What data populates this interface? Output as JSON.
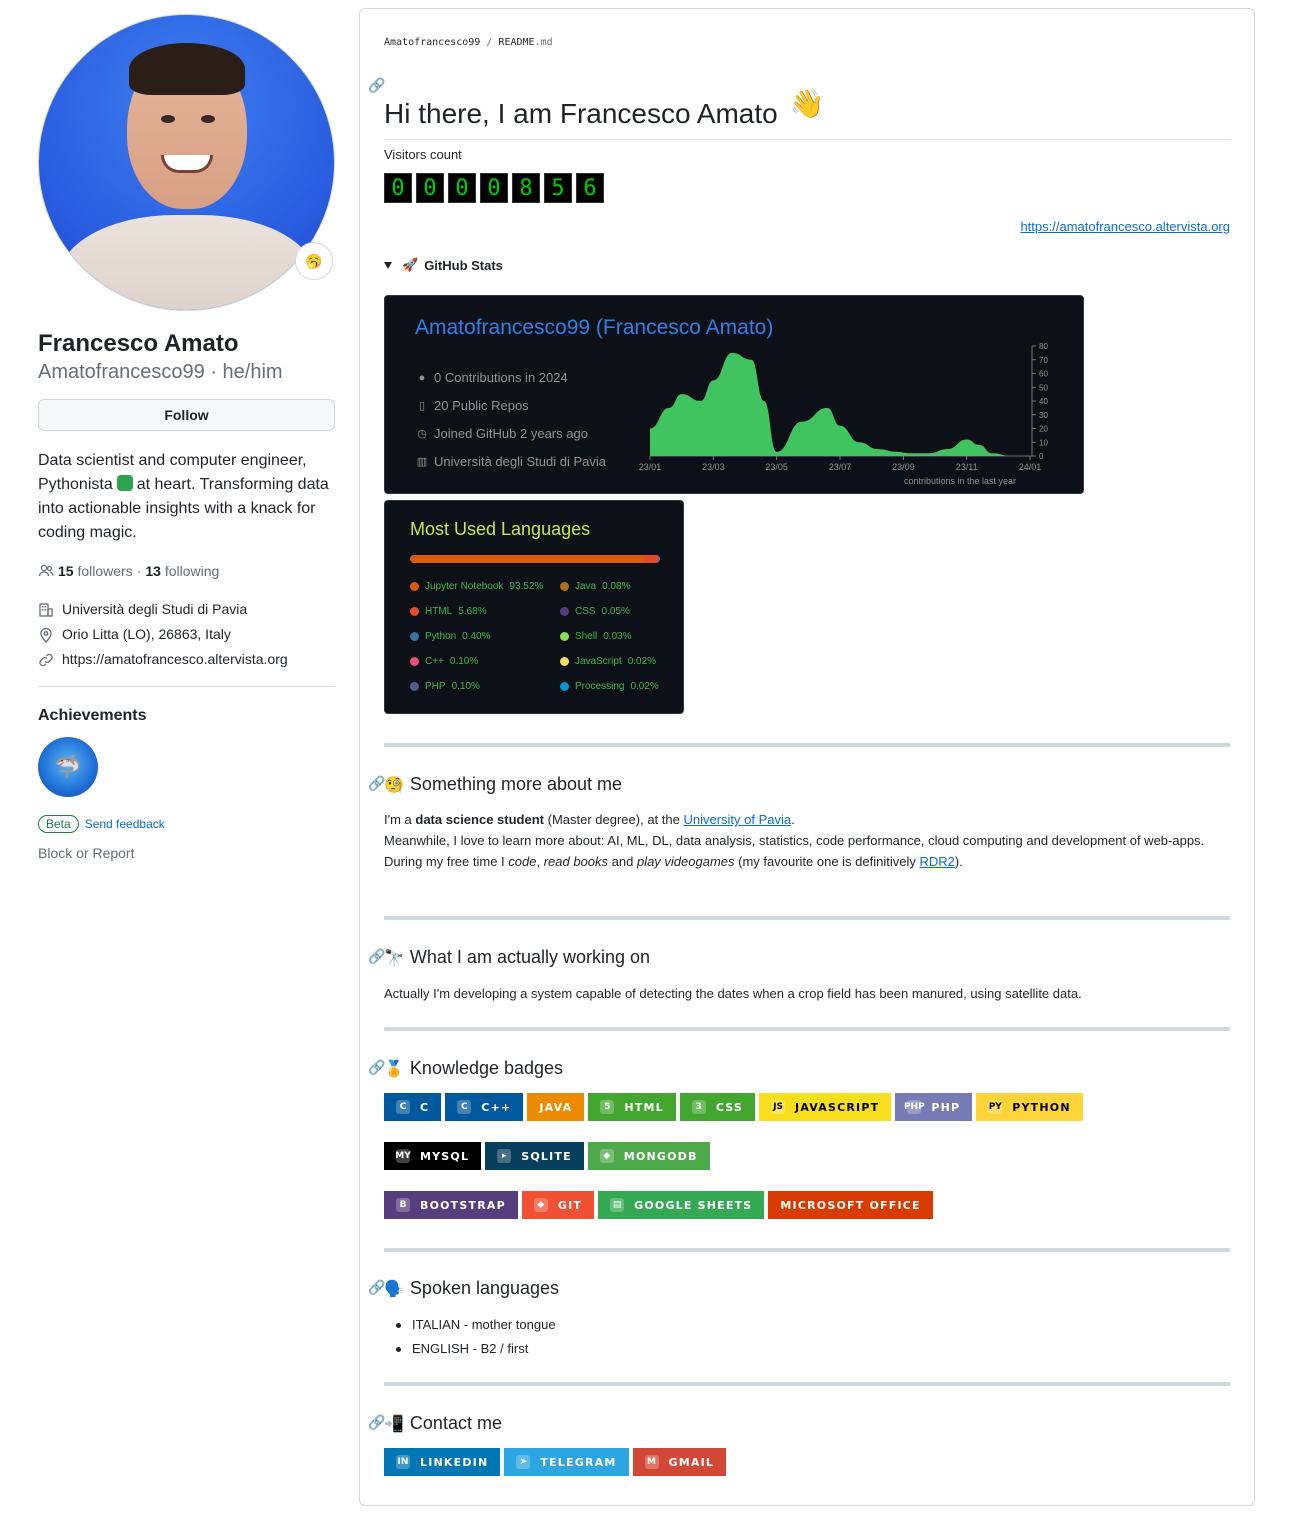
{
  "profile": {
    "name": "Francesco Amato",
    "username": "Amatofrancesco99 · he/him",
    "status_emoji": "🥱",
    "follow_label": "Follow",
    "bio_part1": "Data scientist and computer engineer, Pythonista",
    "bio_part2": "at heart. Transforming data into actionable insights with a knack for coding magic.",
    "followers_count": "15",
    "followers_label": "followers",
    "following_count": "13",
    "following_label": "following",
    "organization": "Università degli Studi di Pavia",
    "location": "Orio Litta (LO), 26863, Italy",
    "website": "https://amatofrancesco.altervista.org",
    "achievements_title": "Achievements",
    "beta_label": "Beta",
    "feedback_label": "Send feedback",
    "block_label": "Block or Report"
  },
  "readme": {
    "crumb_user": "Amatofrancesco99",
    "crumb_sep": "/",
    "crumb_file": "README",
    "crumb_ext": ".md",
    "title": "Hi there, I am Francesco Amato",
    "title_emoji": "👋",
    "visitors_label": "Visitors count",
    "visitor_digits": [
      "0",
      "0",
      "0",
      "0",
      "8",
      "5",
      "6"
    ],
    "site_link": "https://amatofrancesco.altervista.org",
    "details_emoji": "🚀",
    "details_label": "GitHub Stats"
  },
  "stats_card": {
    "title": "Amatofrancesco99 (Francesco Amato)",
    "contributions": "0 Contributions in 2024",
    "repos": "20 Public Repos",
    "joined": "Joined GitHub 2 years ago",
    "org": "Università degli Studi di Pavia",
    "caption": "contributions in the last year"
  },
  "chart_data": {
    "type": "area",
    "title": "",
    "xlabel": "contributions in the last year",
    "ylabel": "",
    "x_ticks": [
      "23/01",
      "23/03",
      "23/05",
      "23/07",
      "23/09",
      "23/11",
      "24/01"
    ],
    "y_ticks": [
      0,
      10,
      20,
      30,
      40,
      50,
      60,
      70,
      80
    ],
    "ylim": [
      0,
      80
    ],
    "series": [
      {
        "x": [
          0,
          0.3,
          0.5,
          0.8,
          1.0,
          1.3,
          1.6,
          1.8,
          2.0,
          2.4,
          2.8,
          3.0,
          3.3,
          3.6,
          3.9,
          4.1,
          4.4,
          4.7,
          5.0,
          5.2,
          5.4,
          5.7,
          6.0
        ],
        "y": [
          20,
          35,
          45,
          40,
          55,
          75,
          70,
          40,
          3,
          25,
          35,
          22,
          10,
          5,
          3,
          2,
          2,
          5,
          12,
          8,
          2,
          0,
          0
        ]
      }
    ],
    "color": "#3fc45f"
  },
  "lang_card": {
    "title": "Most Used Languages",
    "languages": [
      {
        "name": "Jupyter Notebook",
        "pct": "93.52%",
        "value": 93.52,
        "color": "#DA5B0B"
      },
      {
        "name": "Java",
        "pct": "0.08%",
        "value": 0.08,
        "color": "#b07219"
      },
      {
        "name": "HTML",
        "pct": "5.68%",
        "value": 5.68,
        "color": "#e34c26"
      },
      {
        "name": "CSS",
        "pct": "0.05%",
        "value": 0.05,
        "color": "#563d7c"
      },
      {
        "name": "Python",
        "pct": "0.40%",
        "value": 0.4,
        "color": "#3572A5"
      },
      {
        "name": "Shell",
        "pct": "0.03%",
        "value": 0.03,
        "color": "#89e051"
      },
      {
        "name": "C++",
        "pct": "0.10%",
        "value": 0.1,
        "color": "#f34b7d"
      },
      {
        "name": "JavaScript",
        "pct": "0.02%",
        "value": 0.02,
        "color": "#f1e05a"
      },
      {
        "name": "PHP",
        "pct": "0.10%",
        "value": 0.1,
        "color": "#4F5D95"
      },
      {
        "name": "Processing",
        "pct": "0.02%",
        "value": 0.02,
        "color": "#0096D8"
      }
    ]
  },
  "about": {
    "emoji": "🧐",
    "title": "Something more about me",
    "l1_a": "I'm a ",
    "l1_b": "data science student",
    "l1_c": " (Master degree), at the ",
    "l1_link": "University of Pavia",
    "l1_d": ".",
    "l2": "Meanwhile, I love to learn more about: AI, ML, DL, data analysis, statistics, code performance, cloud computing and development of web-apps.",
    "l3_a": "During my free time I ",
    "l3_b": "code",
    "l3_c": ", ",
    "l3_d": "read books",
    "l3_e": " and ",
    "l3_f": "play videogames",
    "l3_g": " (my favourite one is definitively ",
    "l3_link": "RDR2",
    "l3_h": ")."
  },
  "working": {
    "emoji": "🔭",
    "title": "What I am actually working on",
    "text": "Actually I'm developing a system capable of detecting the dates when a crop field has been manured, using satellite data."
  },
  "knowledge": {
    "emoji": "🏅",
    "title": "Knowledge badges",
    "row1": [
      {
        "label": "C",
        "icon": "C",
        "bg": "#00599C",
        "fg": "#ffffff"
      },
      {
        "label": "C++",
        "icon": "C",
        "bg": "#00599C",
        "fg": "#ffffff"
      },
      {
        "label": "JAVA",
        "icon": "",
        "bg": "#ED8B00",
        "fg": "#ffffff"
      },
      {
        "label": "HTML",
        "icon": "5",
        "bg": "#43A72F",
        "fg": "#ffffff"
      },
      {
        "label": "CSS",
        "icon": "3",
        "bg": "#43A72F",
        "fg": "#ffffff"
      },
      {
        "label": "JAVASCRIPT",
        "icon": "JS",
        "bg": "#F7DF1E",
        "fg": "#000000"
      },
      {
        "label": "PHP",
        "icon": "php",
        "bg": "#777BB4",
        "fg": "#ffffff"
      },
      {
        "label": "PYTHON",
        "icon": "py",
        "bg": "#FFD43B",
        "fg": "#000000"
      }
    ],
    "row2": [
      {
        "label": "MYSQL",
        "icon": "My",
        "bg": "#000000",
        "fg": "#ffffff"
      },
      {
        "label": "SQLITE",
        "icon": "▸",
        "bg": "#07405e",
        "fg": "#ffffff"
      },
      {
        "label": "MONGODB",
        "icon": "◆",
        "bg": "#4ea94b",
        "fg": "#ffffff"
      }
    ],
    "row3": [
      {
        "label": "BOOTSTRAP",
        "icon": "B",
        "bg": "#563D7C",
        "fg": "#ffffff"
      },
      {
        "label": "GIT",
        "icon": "◆",
        "bg": "#F05033",
        "fg": "#ffffff"
      },
      {
        "label": "GOOGLE SHEETS",
        "icon": "▤",
        "bg": "#34A853",
        "fg": "#ffffff"
      },
      {
        "label": "MICROSOFT OFFICE",
        "icon": "",
        "bg": "#D83B01",
        "fg": "#ffffff"
      }
    ]
  },
  "spoken": {
    "emoji": "🗣️",
    "title": "Spoken languages",
    "items": [
      "ITALIAN - mother tongue",
      "ENGLISH - B2 / first"
    ]
  },
  "contact": {
    "emoji": "📲",
    "title": "Contact me",
    "badges": [
      {
        "label": "LINKEDIN",
        "icon": "in",
        "bg": "#0077B5",
        "fg": "#ffffff"
      },
      {
        "label": "TELEGRAM",
        "icon": "➤",
        "bg": "#2CA5E0",
        "fg": "#ffffff"
      },
      {
        "label": "GMAIL",
        "icon": "M",
        "bg": "#D14836",
        "fg": "#ffffff"
      }
    ]
  }
}
